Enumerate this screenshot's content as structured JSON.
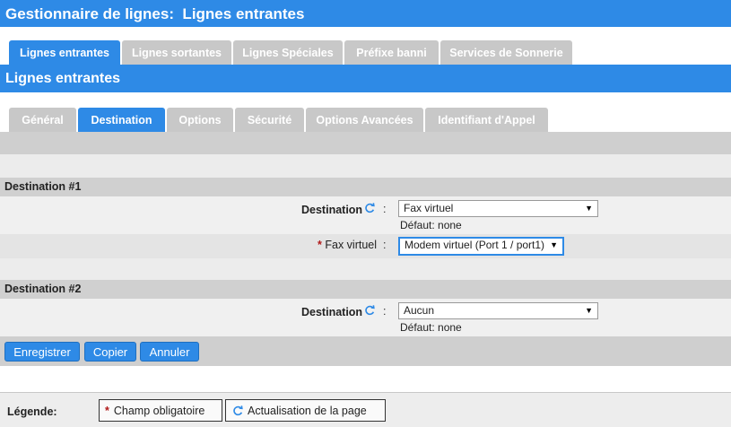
{
  "header": {
    "title": "Gestionnaire de lignes:  Lignes entrantes"
  },
  "main_tabs": [
    {
      "label": "Lignes entrantes",
      "active": true
    },
    {
      "label": "Lignes sortantes",
      "active": false
    },
    {
      "label": "Lignes Spéciales",
      "active": false
    },
    {
      "label": "Préfixe banni",
      "active": false
    },
    {
      "label": "Services de Sonnerie",
      "active": false
    }
  ],
  "section_title": "Lignes entrantes",
  "sub_tabs": [
    {
      "label": "Général",
      "active": false
    },
    {
      "label": "Destination",
      "active": true
    },
    {
      "label": "Options",
      "active": false
    },
    {
      "label": "Sécurité",
      "active": false
    },
    {
      "label": "Options Avancées",
      "active": false
    },
    {
      "label": "Identifiant d'Appel",
      "active": false
    }
  ],
  "destination1": {
    "heading": "Destination #1",
    "dest_label": "Destination",
    "colon": ":",
    "dest_value": "Fax virtuel",
    "default_text": "Défaut: none",
    "fax_required_marker": "*",
    "fax_label": "Fax virtuel",
    "fax_value": "Modem virtuel (Port 1 / port1)"
  },
  "destination2": {
    "heading": "Destination #2",
    "dest_label": "Destination",
    "colon": ":",
    "dest_value": "Aucun",
    "default_text": "Défaut: none"
  },
  "buttons": {
    "save": "Enregistrer",
    "copy": "Copier",
    "cancel": "Annuler"
  },
  "legend": {
    "label": "Légende:",
    "required_marker": "*",
    "required_text": "Champ obligatoire",
    "refresh_text": "Actualisation de la page"
  },
  "icons": {
    "refresh": "refresh-icon",
    "dropdown": "chevron-down-icon"
  },
  "colors": {
    "accent": "#2e8ae6",
    "tab_inactive": "#c8c8c8",
    "required": "#b01919"
  }
}
